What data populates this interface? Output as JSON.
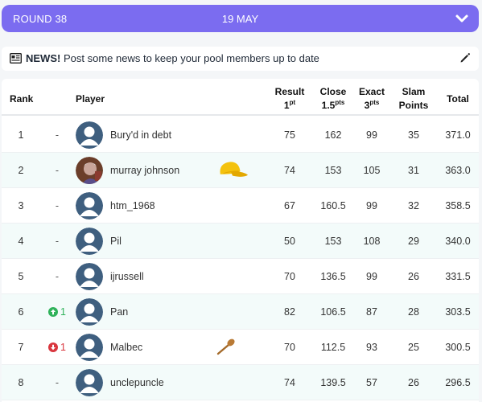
{
  "header": {
    "round": "ROUND 38",
    "date": "19 MAY"
  },
  "news": {
    "bold": "NEWS!",
    "text": "Post some news to keep your pool members up to date"
  },
  "columns": {
    "rank": "Rank",
    "player": "Player",
    "result": "Result",
    "result_pts": "1",
    "result_sup": "pt",
    "close": "Close",
    "close_pts": "1.5",
    "close_sup": "pts",
    "exact": "Exact",
    "exact_pts": "3",
    "exact_sup": "pts",
    "slam": "Slam",
    "slam2": "Points",
    "total": "Total"
  },
  "rows": [
    {
      "rank": "1",
      "move": "-",
      "name": "Bury'd in debt",
      "result": "75",
      "close": "162",
      "exact": "99",
      "slam": "35",
      "total": "371.0"
    },
    {
      "rank": "2",
      "move": "-",
      "name": "murray johnson",
      "result": "74",
      "close": "153",
      "exact": "105",
      "slam": "31",
      "total": "363.0"
    },
    {
      "rank": "3",
      "move": "-",
      "name": "htm_1968",
      "result": "67",
      "close": "160.5",
      "exact": "99",
      "slam": "32",
      "total": "358.5"
    },
    {
      "rank": "4",
      "move": "-",
      "name": "Pil",
      "result": "50",
      "close": "153",
      "exact": "108",
      "slam": "29",
      "total": "340.0"
    },
    {
      "rank": "5",
      "move": "-",
      "name": "ijrussell",
      "result": "70",
      "close": "136.5",
      "exact": "99",
      "slam": "26",
      "total": "331.5"
    },
    {
      "rank": "6",
      "move": "1",
      "name": "Pan",
      "result": "82",
      "close": "106.5",
      "exact": "87",
      "slam": "28",
      "total": "303.5"
    },
    {
      "rank": "7",
      "move": "1",
      "name": "Malbec",
      "result": "70",
      "close": "112.5",
      "exact": "93",
      "slam": "25",
      "total": "300.5"
    },
    {
      "rank": "8",
      "move": "-",
      "name": "unclepuncle",
      "result": "74",
      "close": "139.5",
      "exact": "57",
      "slam": "26",
      "total": "296.5"
    }
  ],
  "colors": {
    "accent": "#7b6cf0",
    "up": "#2fb25a",
    "down": "#d9363e",
    "row_alt": "#f3fbfa"
  },
  "icons": {
    "round_toggle": "chevron-down-icon",
    "news": "newspaper-icon",
    "edit": "pencil-icon",
    "up": "arrow-up-circle-icon",
    "down": "arrow-down-circle-icon",
    "badge_row2": "cap-icon",
    "badge_row7": "wooden-spoon-icon"
  }
}
